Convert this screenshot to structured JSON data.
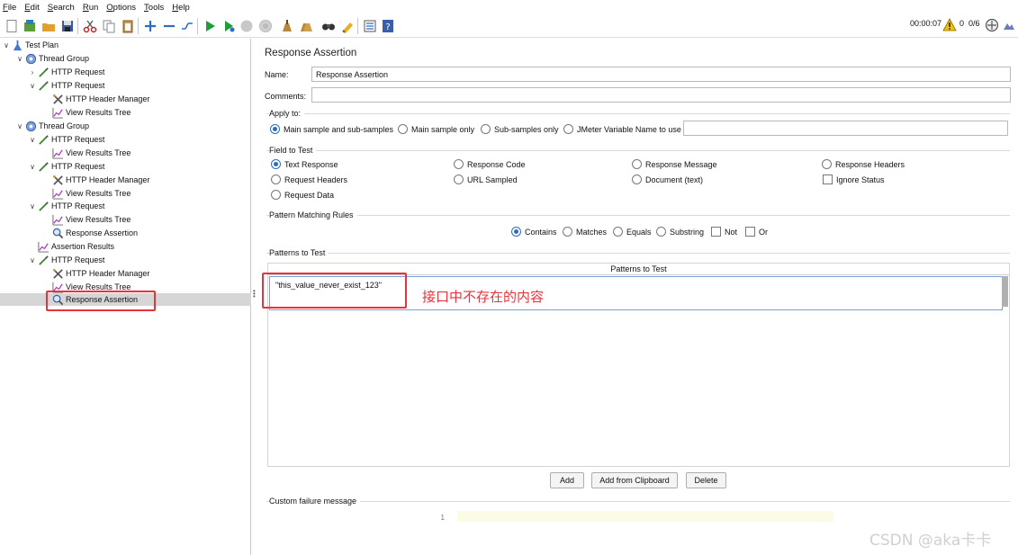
{
  "menu": {
    "items": [
      {
        "u": "F",
        "rest": "ile"
      },
      {
        "u": "E",
        "rest": "dit"
      },
      {
        "u": "S",
        "rest": "earch"
      },
      {
        "u": "R",
        "rest": "un"
      },
      {
        "u": "O",
        "rest": "ptions"
      },
      {
        "u": "T",
        "rest": "ools"
      },
      {
        "u": "H",
        "rest": "elp"
      }
    ]
  },
  "status": {
    "timer": "00:00:07",
    "warnings": "0",
    "threads": "0/6"
  },
  "tree": {
    "nodes": [
      {
        "label": "Test Plan",
        "icon": "test-plan-icon",
        "toggle": "∨"
      },
      {
        "label": "Thread Group",
        "icon": "gear-icon",
        "toggle": "∨"
      },
      {
        "label": "HTTP Request",
        "icon": "pipette-icon",
        "toggle": "›"
      },
      {
        "label": "HTTP Request",
        "icon": "pipette-icon",
        "toggle": "∨"
      },
      {
        "label": "HTTP Header Manager",
        "icon": "wrench-icon",
        "toggle": ""
      },
      {
        "label": "View Results Tree",
        "icon": "chart-icon",
        "toggle": ""
      },
      {
        "label": "Thread Group",
        "icon": "gear-icon",
        "toggle": "∨"
      },
      {
        "label": "HTTP Request",
        "icon": "pipette-icon",
        "toggle": "∨"
      },
      {
        "label": "View Results Tree",
        "icon": "chart-icon",
        "toggle": ""
      },
      {
        "label": "HTTP Request",
        "icon": "pipette-icon",
        "toggle": "∨"
      },
      {
        "label": "HTTP Header Manager",
        "icon": "wrench-icon",
        "toggle": ""
      },
      {
        "label": "View Results Tree",
        "icon": "chart-icon",
        "toggle": ""
      },
      {
        "label": "HTTP Request",
        "icon": "pipette-icon",
        "toggle": "∨"
      },
      {
        "label": "View Results Tree",
        "icon": "chart-icon",
        "toggle": ""
      },
      {
        "label": "Response Assertion",
        "icon": "magnifier-icon",
        "toggle": ""
      },
      {
        "label": "Assertion Results",
        "icon": "chart-icon",
        "toggle": ""
      },
      {
        "label": "HTTP Request",
        "icon": "pipette-icon",
        "toggle": "∨"
      },
      {
        "label": "HTTP Header Manager",
        "icon": "wrench-icon",
        "toggle": ""
      },
      {
        "label": "View Results Tree",
        "icon": "chart-icon",
        "toggle": ""
      },
      {
        "label": "Response Assertion",
        "icon": "magnifier-icon",
        "toggle": ""
      }
    ]
  },
  "panel": {
    "title": "Response Assertion",
    "name_label": "Name:",
    "name_value": "Response Assertion",
    "comments_label": "Comments:",
    "comments_value": "",
    "apply_to": {
      "title": "Apply to:",
      "options": [
        "Main sample and sub-samples",
        "Main sample only",
        "Sub-samples only",
        "JMeter Variable Name to use"
      ],
      "selected": "Main sample and sub-samples",
      "variable_value": ""
    },
    "field_to_test": {
      "title": "Field to Test",
      "options": [
        "Text Response",
        "Response Code",
        "Response Message",
        "Response Headers",
        "Request Headers",
        "URL Sampled",
        "Document (text)",
        "Request Data"
      ],
      "ignore_status_label": "Ignore Status",
      "selected": "Text Response"
    },
    "pattern_rules": {
      "title": "Pattern Matching Rules",
      "options": [
        "Contains",
        "Matches",
        "Equals",
        "Substring"
      ],
      "selected": "Contains",
      "not_label": "Not",
      "or_label": "Or"
    },
    "patterns": {
      "title": "Patterns to Test",
      "column_header": "Patterns to Test",
      "rows": [
        "\"this_value_never_exist_123\""
      ]
    },
    "annotation": "接口中不存在的内容",
    "buttons": {
      "add": "Add",
      "add_clipboard": "Add from Clipboard",
      "delete": "Delete"
    },
    "failure": {
      "title": "Custom failure message",
      "line_number": "1"
    }
  },
  "watermark": "CSDN @aka卡卡"
}
